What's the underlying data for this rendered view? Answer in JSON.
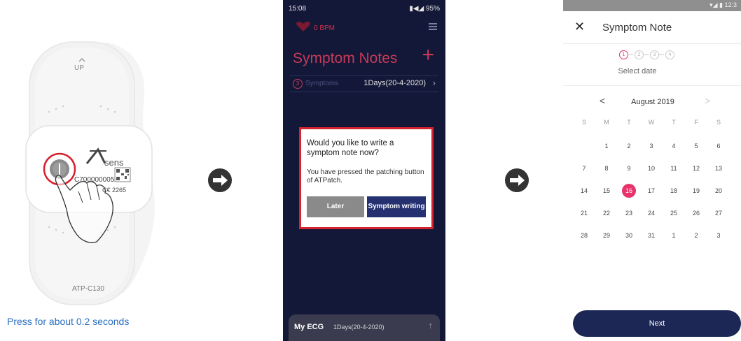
{
  "device": {
    "label_up": "UP",
    "brand": "sens",
    "serial": "C700000005",
    "cert": "2265",
    "model": "ATP-C130",
    "caption": "Press for about 0.2 seconds"
  },
  "phone_dark": {
    "status_time": "15:08",
    "status_right": "95%",
    "bpm": "0 BPM",
    "title": "Symptom Notes",
    "plus": "+",
    "symptom_badge": "3",
    "symptom_label": "Symptoms",
    "symptom_date": "1Days(20-4-2020)",
    "chevron": "›",
    "dialog": {
      "question": "Would you like to write a symptom note now?",
      "message": "You have pressed the patching button of ATPatch.",
      "later_label": "Later",
      "write_label": "Symptom writing"
    },
    "ecg": {
      "label": "My ECG",
      "date": "1Days(20-4-2020)",
      "up": "↑"
    }
  },
  "phone_light": {
    "status_icons": "▾◢ ▮ 12:3",
    "close_icon": "✕",
    "title": "Symptom Note",
    "steps": [
      "1",
      "2",
      "3",
      "4"
    ],
    "select_date": "Select date",
    "month": "August 2019",
    "prev": "<",
    "next_month": ">",
    "weekdays": [
      "S",
      "M",
      "T",
      "W",
      "T",
      "F",
      "S"
    ],
    "weeks": [
      [
        "",
        "",
        "1",
        "2",
        "3",
        "4",
        "5",
        "6"
      ],
      [
        "7",
        "8",
        "9",
        "10",
        "11",
        "12",
        "13"
      ],
      [
        "14",
        "15",
        "16",
        "17",
        "18",
        "19",
        "20"
      ],
      [
        "21",
        "22",
        "23",
        "24",
        "25",
        "26",
        "27"
      ],
      [
        "28",
        "29",
        "30",
        "31",
        "1",
        "2",
        "3"
      ]
    ],
    "selected_day": "16",
    "next_label": "Next"
  },
  "colors": {
    "dark_bg": "#141838",
    "accent_red": "#c63a58",
    "dialog_border": "#d5232f",
    "button_navy": "#243070",
    "selected_pink": "#e8346b",
    "next_button": "#1c2756"
  }
}
